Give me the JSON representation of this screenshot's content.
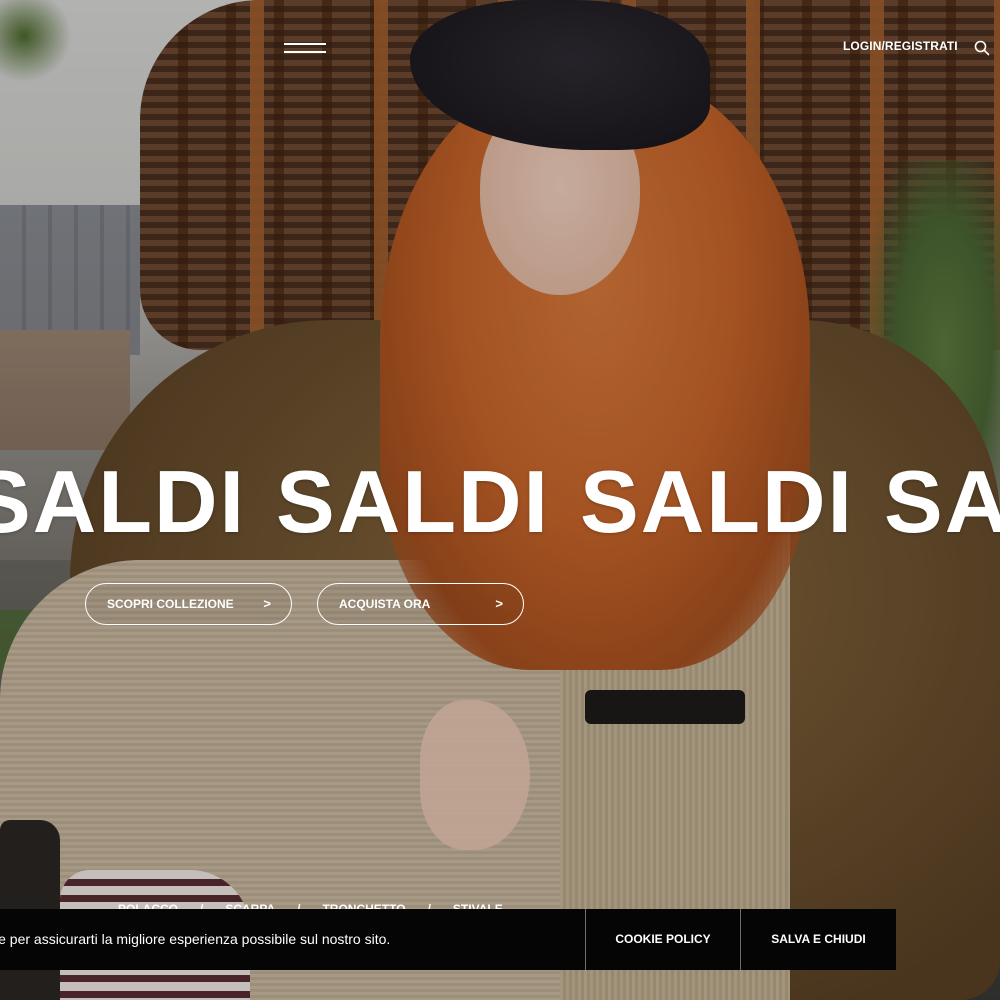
{
  "header": {
    "menu_icon": "hamburger-menu-icon",
    "login_label": "LOGIN/REGISTRATI",
    "search_icon": "search-icon"
  },
  "hero": {
    "marquee_words": [
      "SALDI",
      "SALDI",
      "SALDI",
      "SALDI"
    ],
    "buttons": [
      {
        "label": "SCOPRI COLLEZIONE",
        "arrow": ">"
      },
      {
        "label": "ACQUISTA ORA",
        "arrow": ">"
      }
    ]
  },
  "categories": {
    "items": [
      "POLACCO",
      "SCARPA",
      "TRONCHETTO",
      "STIVALE"
    ],
    "separator": "/"
  },
  "cookie_banner": {
    "text": "kie per assicurarti la migliore esperienza possibile sul nostro sito.",
    "policy_label": "COOKIE POLICY",
    "save_label": "SALVA E CHIUDI",
    "background": "#050505"
  }
}
